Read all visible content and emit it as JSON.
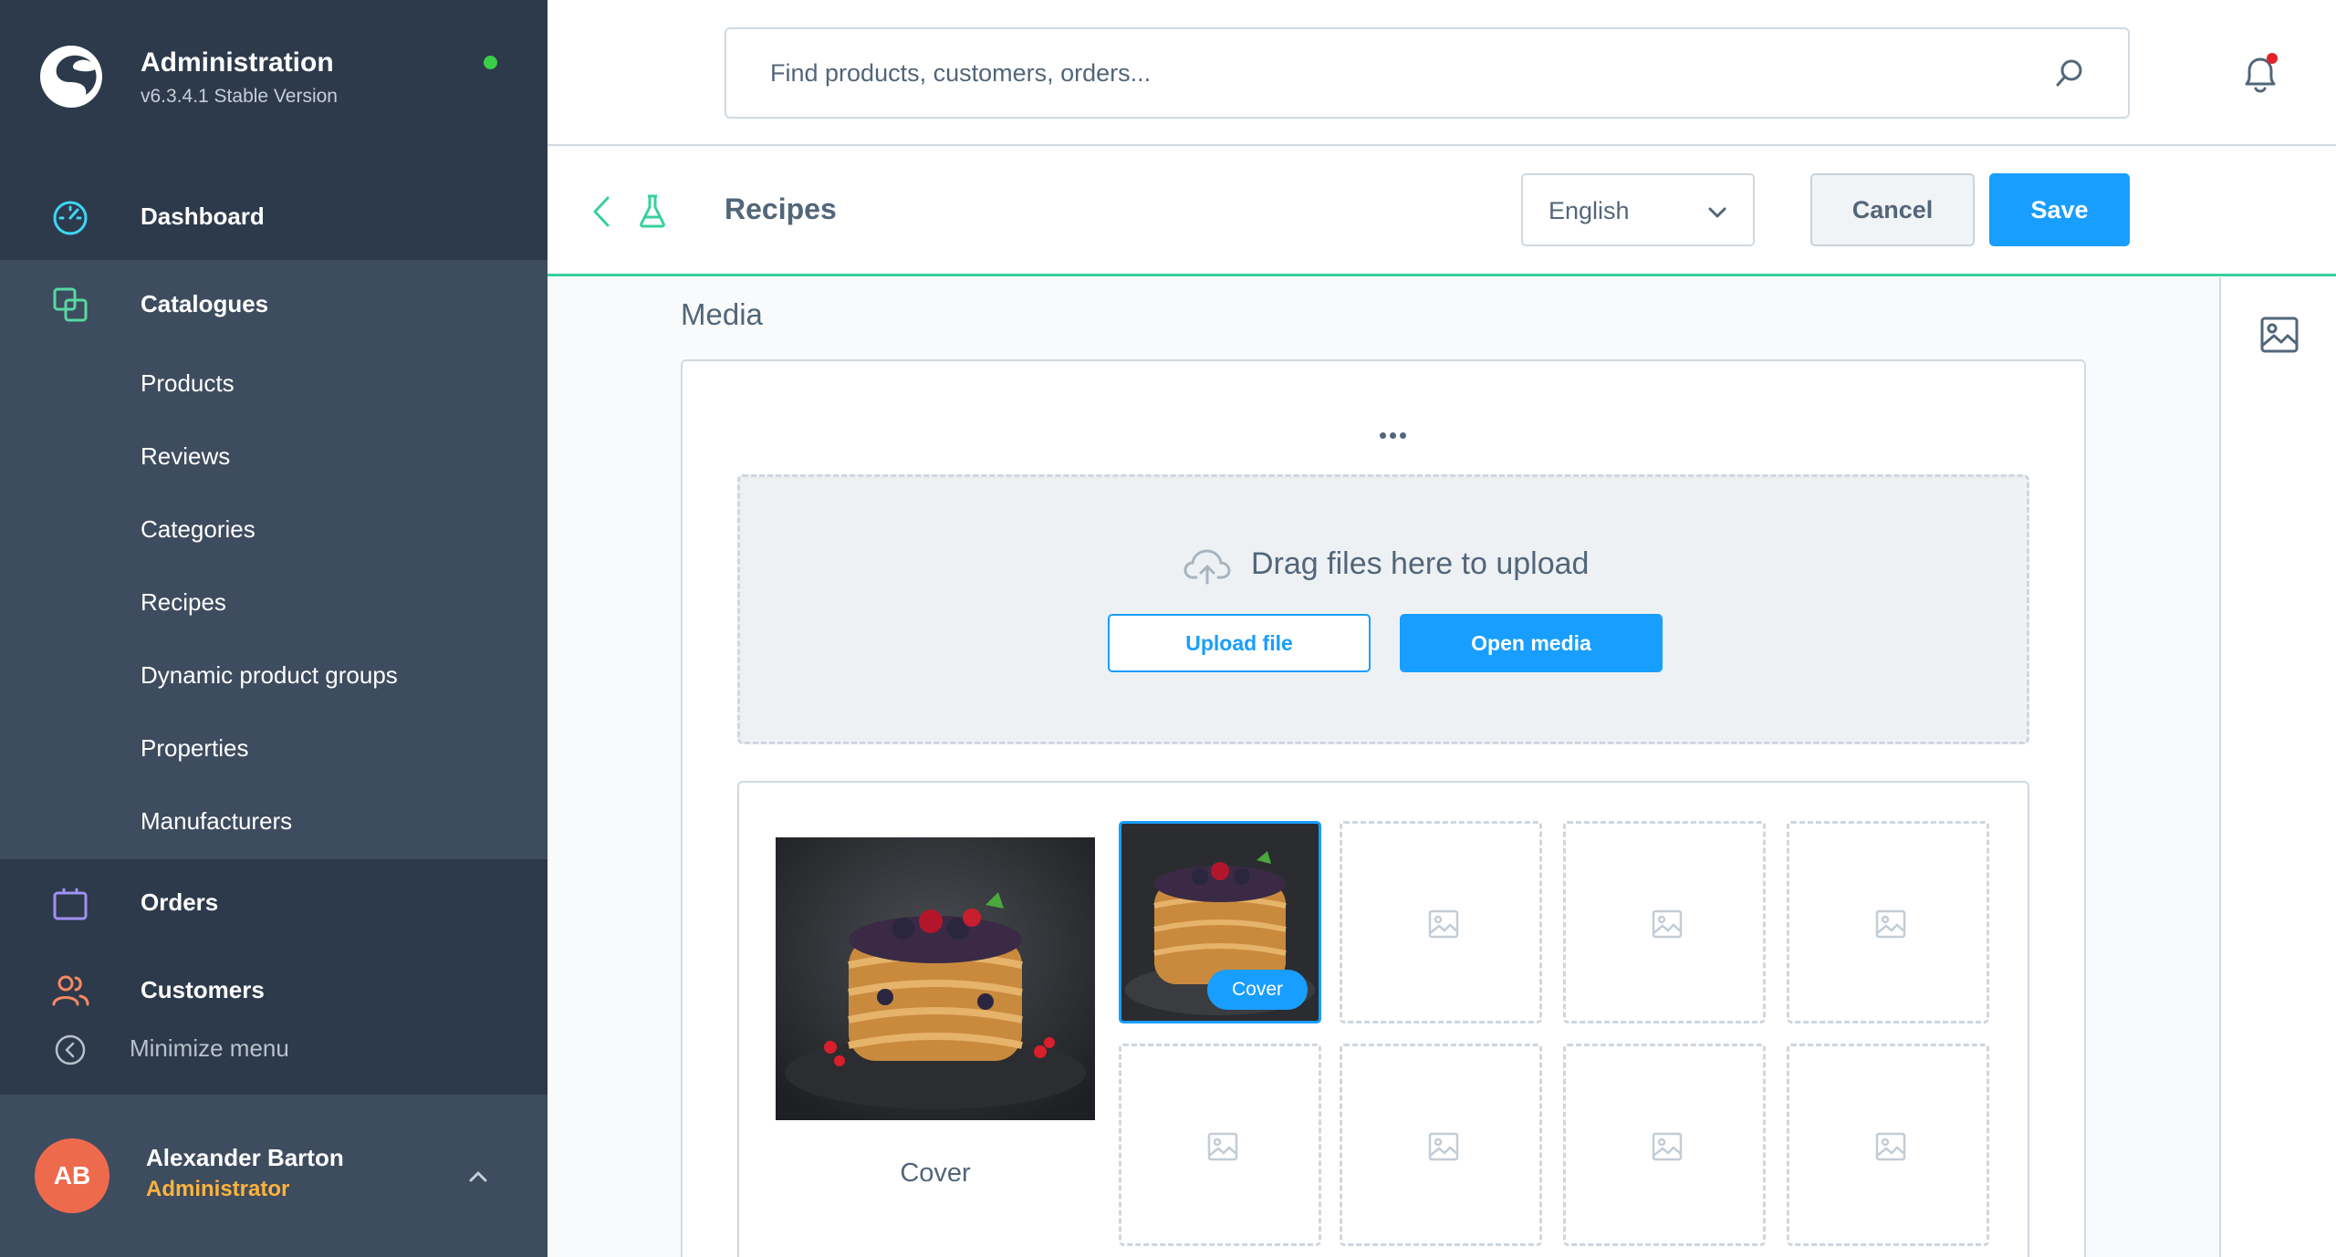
{
  "app": {
    "title": "Administration",
    "version": "v6.3.4.1 Stable Version",
    "logo_icon": "shopware-logo-icon",
    "status_color": "#37d046"
  },
  "sidebar": {
    "dashboard": {
      "label": "Dashboard",
      "icon": "speedometer-icon"
    },
    "catalogues": {
      "label": "Catalogues",
      "icon": "catalogue-icon",
      "items": [
        {
          "label": "Products"
        },
        {
          "label": "Reviews"
        },
        {
          "label": "Categories"
        },
        {
          "label": "Recipes"
        },
        {
          "label": "Dynamic product groups"
        },
        {
          "label": "Properties"
        },
        {
          "label": "Manufacturers"
        }
      ]
    },
    "orders": {
      "label": "Orders",
      "icon": "shopping-bag-icon"
    },
    "customers": {
      "label": "Customers",
      "icon": "users-icon"
    },
    "minimize_label": "Minimize menu",
    "user": {
      "initials": "AB",
      "name": "Alexander Barton",
      "role": "Administrator"
    }
  },
  "topbar": {
    "search_placeholder": "Find products, customers, orders...",
    "notification_icon": "bell-icon"
  },
  "smartbar": {
    "title": "Recipes",
    "language": "English",
    "cancel_label": "Cancel",
    "save_label": "Save"
  },
  "media": {
    "section_title": "Media",
    "drop_text": "Drag files here to upload",
    "upload_label": "Upload file",
    "open_media_label": "Open media",
    "cover_caption": "Cover",
    "cover_badge": "Cover",
    "empty_slot_icon": "image-placeholder-icon"
  },
  "colors": {
    "sidebar_dark": "#2d3a4b",
    "sidebar": "#3d4c5e",
    "primary": "#189eff",
    "accent_green": "#37d09b",
    "user_role": "#ffb33c",
    "avatar": "#ee6a4d"
  }
}
